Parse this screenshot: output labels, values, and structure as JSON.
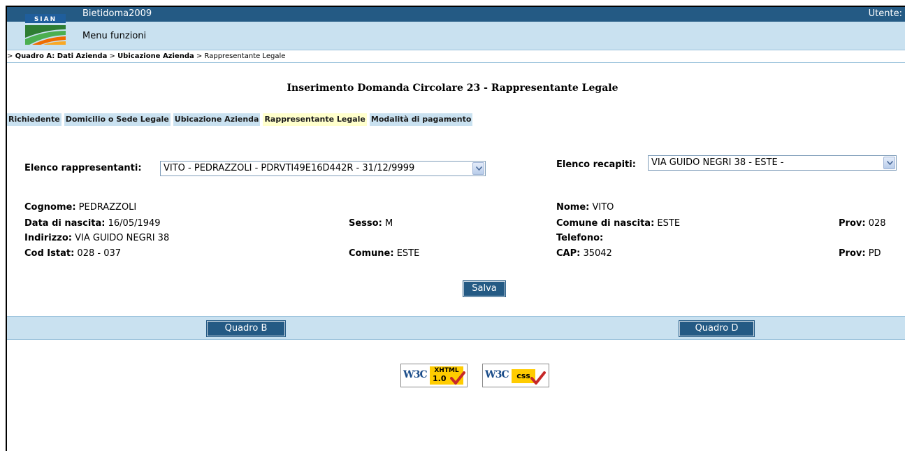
{
  "app": {
    "title": "Bietidoma2009",
    "user_label": "Utente:",
    "logo_text": "SIAN"
  },
  "menu": {
    "label": "Menu funzioni"
  },
  "breadcrumb": {
    "prefix": "> ",
    "level1": "Quadro A: Dati Azienda",
    "sep": " > ",
    "level2": "Ubicazione Azienda",
    "level3": "Rappresentante Legale"
  },
  "page": {
    "title": "Inserimento Domanda Circolare 23 - Rappresentante Legale"
  },
  "tabs": [
    {
      "label": "Richiedente",
      "active": false
    },
    {
      "label": "Domicilio o Sede Legale",
      "active": false
    },
    {
      "label": "Ubicazione Azienda",
      "active": false
    },
    {
      "label": "Rappresentante Legale",
      "active": true
    },
    {
      "label": "Modalità di pagamento",
      "active": false
    }
  ],
  "form": {
    "rappresentanti_label": "Elenco rappresentanti:",
    "rappresentanti_value": "VITO - PEDRAZZOLI - PDRVTI49E16D442R - 31/12/9999",
    "recapiti_label": "Elenco recapiti:",
    "recapiti_value": "VIA GUIDO NEGRI 38 - ESTE -"
  },
  "details": {
    "cognome_label": "Cognome:",
    "cognome": "PEDRAZZOLI",
    "nome_label": "Nome:",
    "nome": "VITO",
    "data_nascita_label": "Data di nascita:",
    "data_nascita": "16/05/1949",
    "sesso_label": "Sesso:",
    "sesso": "M",
    "comune_nascita_label": "Comune di nascita:",
    "comune_nascita": "ESTE",
    "prov_nascita_label": "Prov:",
    "prov_nascita": "028",
    "indirizzo_label": "Indirizzo:",
    "indirizzo": "VIA GUIDO NEGRI 38",
    "telefono_label": "Telefono:",
    "telefono": "",
    "cod_istat_label": "Cod Istat:",
    "cod_istat": "028 - 037",
    "comune_label": "Comune:",
    "comune": "ESTE",
    "cap_label": "CAP:",
    "cap": "35042",
    "prov_label": "Prov:",
    "prov": "PD"
  },
  "buttons": {
    "save": "Salva",
    "prev": "Quadro B",
    "next": "Quadro D"
  },
  "badges": {
    "xhtml_w3c": "W3C",
    "xhtml_tag": "XHTML",
    "xhtml_ver": "1.0",
    "css_w3c": "W3C",
    "css_tag": "css"
  },
  "colors": {
    "header": "#245a84",
    "menu_bg": "#c9e1f0",
    "active_tab": "#ffffcc"
  }
}
